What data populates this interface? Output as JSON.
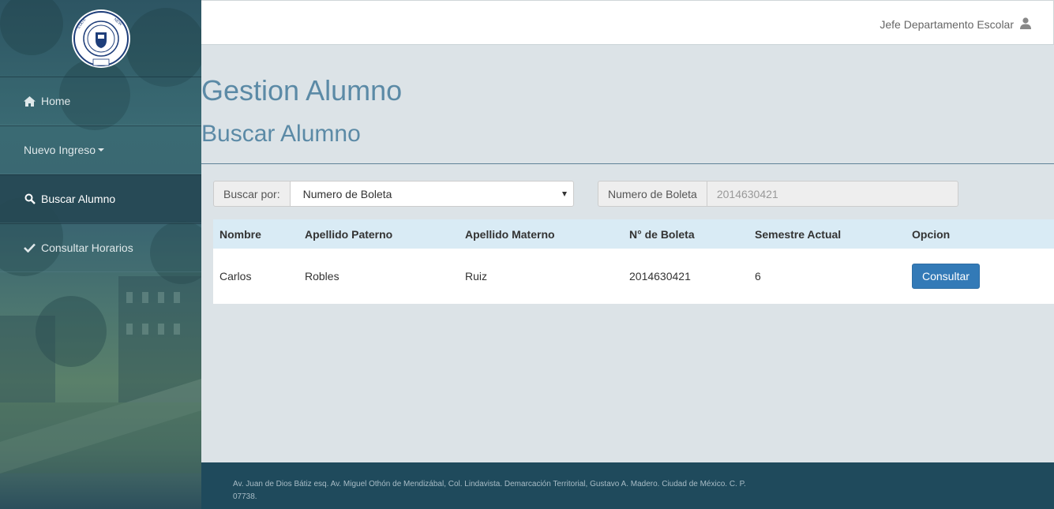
{
  "header": {
    "user_name": "Jefe Departamento Escolar",
    "user_icon": "user-icon"
  },
  "logo": {
    "seal_text": "STATE UNIVERSITY OF NEW YORK",
    "motto": "LET EACH BECOME ALL HE IS CAPABLE OF BEING",
    "year": "1948",
    "banner": "TO SERVE"
  },
  "sidebar": {
    "items": [
      {
        "label": "Home",
        "icon": "home-icon",
        "active": false
      },
      {
        "label": "Nuevo Ingreso",
        "icon": "caret-down-icon",
        "active": false
      },
      {
        "label": "Buscar Alumno",
        "icon": "search-icon",
        "active": true
      },
      {
        "label": "Consultar Horarios",
        "icon": "check-icon",
        "active": false
      }
    ]
  },
  "page": {
    "title": "Gestion Alumno",
    "subtitle": "Buscar Alumno"
  },
  "search": {
    "by_label": "Buscar por:",
    "by_selected": "Numero de Boleta",
    "field_label": "Numero de Boleta",
    "field_value": "2014630421"
  },
  "table": {
    "headers": [
      "Nombre",
      "Apellido Paterno",
      "Apellido Materno",
      "N° de Boleta",
      "Semestre Actual",
      "Opcion"
    ],
    "rows": [
      {
        "nombre": "Carlos",
        "apellido_paterno": "Robles",
        "apellido_materno": "Ruiz",
        "boleta": "2014630421",
        "semestre": "6",
        "action_label": "Consultar"
      }
    ]
  },
  "footer": {
    "address": "Av. Juan de Dios Bátiz esq. Av. Miguel Othón de Mendizábal, Col. Lindavista. Demarcación Territorial, Gustavo A. Madero. Ciudad de México. C. P. 07738."
  },
  "colors": {
    "heading": "#5b8aa6",
    "primary_button": "#337ab7",
    "table_header": "#d9ebf5",
    "footer": "#1f4a5c",
    "sidebar_active": "#264854"
  }
}
